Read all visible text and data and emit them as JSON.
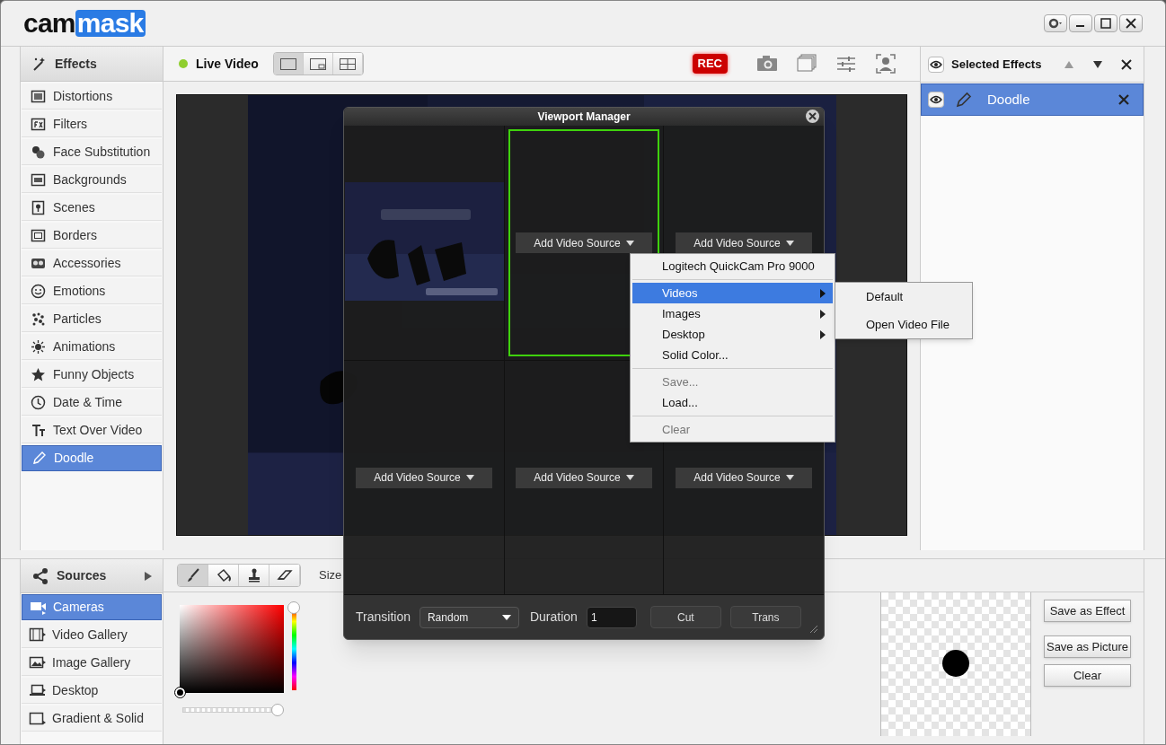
{
  "logo": {
    "left": "cam",
    "right": "mask"
  },
  "effects_panel": {
    "title": "Effects",
    "items": [
      {
        "label": "Distortions",
        "selected": false
      },
      {
        "label": "Filters",
        "selected": false
      },
      {
        "label": "Face Substitution",
        "selected": false
      },
      {
        "label": "Backgrounds",
        "selected": false
      },
      {
        "label": "Scenes",
        "selected": false
      },
      {
        "label": "Borders",
        "selected": false
      },
      {
        "label": "Accessories",
        "selected": false
      },
      {
        "label": "Emotions",
        "selected": false
      },
      {
        "label": "Particles",
        "selected": false
      },
      {
        "label": "Animations",
        "selected": false
      },
      {
        "label": "Funny Objects",
        "selected": false
      },
      {
        "label": "Date & Time",
        "selected": false
      },
      {
        "label": "Text Over Video",
        "selected": false
      },
      {
        "label": "Doodle",
        "selected": true
      }
    ]
  },
  "live_video": {
    "title": "Live Video",
    "layouts": [
      {
        "kind": "single",
        "selected": true
      },
      {
        "kind": "pip",
        "selected": false
      },
      {
        "kind": "quad",
        "selected": false
      }
    ],
    "rec": "REC"
  },
  "selected_effects": {
    "title": "Selected Effects",
    "items": [
      {
        "label": "Doodle",
        "selected": true
      }
    ]
  },
  "sources_panel": {
    "title": "Sources",
    "items": [
      {
        "label": "Cameras",
        "selected": true
      },
      {
        "label": "Video Gallery",
        "selected": false
      },
      {
        "label": "Image Gallery",
        "selected": false
      },
      {
        "label": "Desktop",
        "selected": false
      },
      {
        "label": "Gradient & Solid",
        "selected": false
      }
    ]
  },
  "doodle_tools": {
    "tools": [
      {
        "kind": "brush",
        "selected": true
      },
      {
        "kind": "fill",
        "selected": false
      },
      {
        "kind": "stamp",
        "selected": false
      },
      {
        "kind": "eraser",
        "selected": false
      }
    ],
    "size_label": "Size",
    "hue_slider": {
      "level": 1
    },
    "opacity_slider": {
      "level": 1
    }
  },
  "preview_buttons": [
    "Save as Effect",
    "Save as Picture",
    "Clear"
  ],
  "viewport_manager": {
    "title": "Viewport Manager",
    "cells": [
      {
        "kind": "picture",
        "selected": false
      },
      {
        "kind": "empty",
        "selected": true,
        "button": "Add Video Source"
      },
      {
        "kind": "empty",
        "selected": false,
        "button": "Add Video Source"
      },
      {
        "kind": "empty",
        "selected": false,
        "button": "Add Video Source"
      },
      {
        "kind": "empty",
        "selected": false,
        "button": "Add Video Source"
      },
      {
        "kind": "empty",
        "selected": false,
        "button": "Add Video Source"
      }
    ],
    "transition_label": "Transition",
    "transition_value": "Random",
    "duration_label": "Duration",
    "duration_value": "1",
    "buttons": [
      "Cut",
      "Trans"
    ]
  },
  "source_menu": {
    "groups": [
      [
        {
          "label": "Logitech QuickCam Pro 9000",
          "submenu": false,
          "selected": false,
          "disabled": false
        }
      ],
      [
        {
          "label": "Videos",
          "submenu": true,
          "selected": true,
          "disabled": false
        },
        {
          "label": "Images",
          "submenu": true,
          "selected": false,
          "disabled": false
        },
        {
          "label": "Desktop",
          "submenu": true,
          "selected": false,
          "disabled": false
        },
        {
          "label": "Solid Color...",
          "submenu": false,
          "selected": false,
          "disabled": false
        }
      ],
      [
        {
          "label": "Save...",
          "submenu": false,
          "selected": false,
          "disabled": true
        },
        {
          "label": "Load...",
          "submenu": false,
          "selected": false,
          "disabled": false
        }
      ],
      [
        {
          "label": "Clear",
          "submenu": false,
          "selected": false,
          "disabled": true
        }
      ]
    ]
  },
  "submenu": {
    "items": [
      {
        "label": "Default"
      },
      {
        "label": "Open Video File"
      }
    ]
  }
}
